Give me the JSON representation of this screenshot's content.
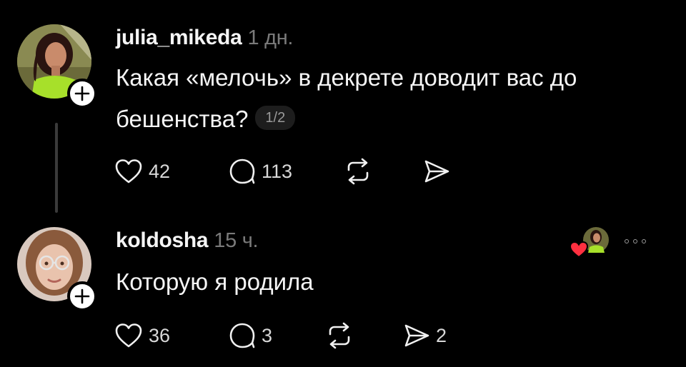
{
  "posts": [
    {
      "username": "julia_mikeda",
      "time": "1 дн.",
      "text": "Какая «мелочь» в декрете доводит вас до бешенства?",
      "page_indicator": "1/2",
      "likes": "42",
      "replies": "113",
      "reposts": "",
      "shares": "",
      "avatar_icon": "profile-photo-woman-green-top",
      "follow_icon": "plus-icon"
    },
    {
      "username": "koldosha",
      "time": "15 ч.",
      "text": "Которую я родила",
      "likes": "36",
      "replies": "3",
      "reposts": "",
      "shares": "2",
      "avatar_icon": "profile-photo-woman-glasses",
      "follow_icon": "plus-icon",
      "liked_by_author": true
    }
  ],
  "icons": {
    "like": "heart-outline-icon",
    "reply": "speech-bubble-icon",
    "repost": "repost-arrows-icon",
    "share": "send-paper-plane-icon",
    "liked_by": "red-heart-with-avatar-icon",
    "more": "more-dots-icon"
  },
  "colors": {
    "background": "#000000",
    "text": "#f5f5f5",
    "muted": "#7a7a7a",
    "heart_red": "#ff3040",
    "avatar_top_green": "#9fdc2c"
  }
}
